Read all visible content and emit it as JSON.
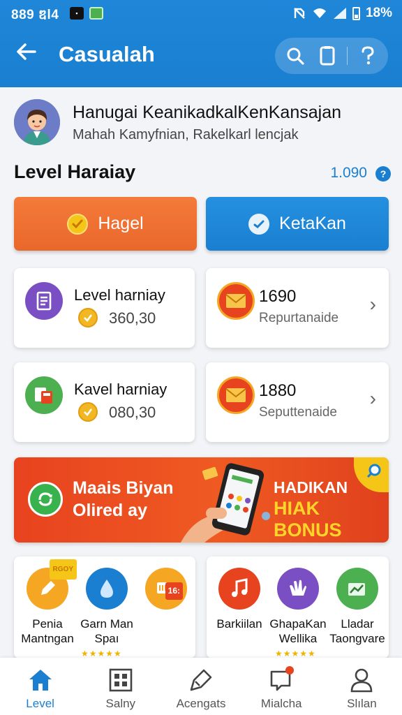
{
  "status_bar": {
    "time": "889 ឌl4",
    "battery": "18%"
  },
  "header": {
    "title": "Casualah"
  },
  "profile": {
    "name": "Hanugai KeanikadkalKenKansajan",
    "subtitle": "Mahah Kamyfnian, Rakelkarl lencjak"
  },
  "level": {
    "title": "Level Haraiay",
    "count": "1.090"
  },
  "buttons": {
    "primary": "Hagel",
    "secondary": "KetaKan"
  },
  "stats": [
    {
      "label": "Level harniay",
      "value": "360,30"
    },
    {
      "value": "1690",
      "label": "Repurtanaide"
    },
    {
      "label": "Kavel harniay",
      "value": "080,30"
    },
    {
      "value": "1880",
      "label": "Seputtenaide"
    }
  ],
  "banner": {
    "left_line1": "Maais Biyan",
    "left_line2": "Olired ay",
    "right_line1": "HADIKAN",
    "right_line2": "HIAK BONUS"
  },
  "apps": {
    "left": [
      {
        "badge": "RGOY",
        "label_line1": "Penia",
        "label_line2": "Mantngan"
      },
      {
        "label_line1": "Garn Man",
        "label_line2": "Spaı"
      },
      {
        "badge": "16:"
      }
    ],
    "right": [
      {
        "label_line1": "Barkiilan",
        "label_line2": ""
      },
      {
        "label_line1": "GhapaKan",
        "label_line2": "Wellika"
      },
      {
        "label_line1": "Lladar",
        "label_line2": "Taongvare"
      }
    ],
    "stars": "★★★★★"
  },
  "nav": [
    {
      "label": "Level",
      "active": true
    },
    {
      "label": "Salny"
    },
    {
      "label": "Acengats"
    },
    {
      "label": "Mialcha"
    },
    {
      "label": "Slılan"
    }
  ],
  "colors": {
    "primary": "#1a7fd1",
    "accent_orange": "#e9672b",
    "banner_red": "#e8431f",
    "bonus_yellow": "#ffd42a"
  }
}
